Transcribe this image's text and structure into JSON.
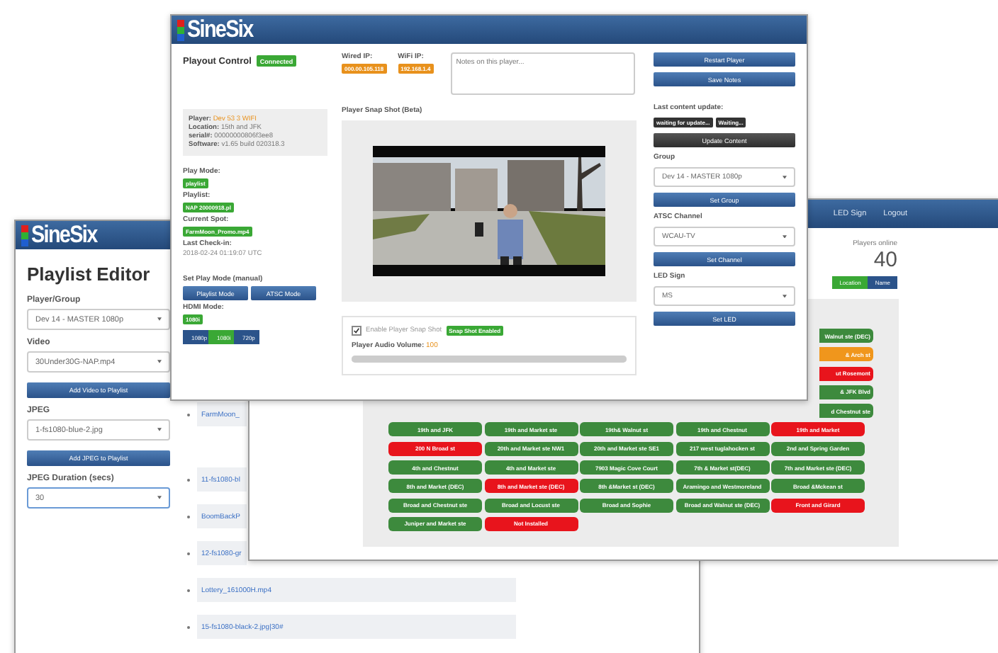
{
  "dashboard": {
    "nav": [
      "LED Sign",
      "Logout"
    ],
    "players_online_label": "Players online",
    "players_online": "40",
    "sort_toggle": [
      {
        "label": "Location",
        "selected": true
      },
      {
        "label": "Name",
        "selected": false
      }
    ],
    "locations": [
      {
        "kind": "partial",
        "cells": [
          {
            "label": "Walnut ste (DEC)",
            "color": "#3d8a3d"
          }
        ]
      },
      {
        "kind": "partial",
        "cells": [
          {
            "label": "& Arch st",
            "color": "#f0961c"
          }
        ]
      },
      {
        "kind": "partial",
        "cells": [
          {
            "label": "ut Rosemont",
            "color": "#e8141c"
          }
        ]
      },
      {
        "kind": "partial",
        "cells": [
          {
            "label": "& JFK Blvd",
            "color": "#3d8a3d"
          }
        ]
      },
      {
        "kind": "partial",
        "cells": [
          {
            "label": "d Chestnut ste",
            "color": "#3d8a3d"
          }
        ]
      },
      {
        "kind": "full",
        "cells": [
          {
            "label": "19th and JFK",
            "color": "#3d8a3d"
          },
          {
            "label": "19th and Market ste",
            "color": "#3d8a3d"
          },
          {
            "label": "19th& Walnut st",
            "color": "#3d8a3d"
          },
          {
            "label": "19th and Chestnut",
            "color": "#3d8a3d"
          },
          {
            "label": "19th and Market",
            "color": "#e8141c"
          }
        ]
      },
      {
        "kind": "full",
        "cells": [
          {
            "label": "200 N Broad st",
            "color": "#e8141c"
          },
          {
            "label": "20th and Market ste NW1",
            "color": "#3d8a3d"
          },
          {
            "label": "20th and Market ste SE1",
            "color": "#3d8a3d"
          },
          {
            "label": "217 west tuglahocken st",
            "color": "#3d8a3d"
          },
          {
            "label": "2nd and Spring Garden",
            "color": "#3d8a3d"
          }
        ]
      },
      {
        "kind": "full",
        "cells": [
          {
            "label": "4th and Chestnut",
            "color": "#3d8a3d"
          },
          {
            "label": "4th and Market ste",
            "color": "#3d8a3d"
          },
          {
            "label": "7903 Magic Cove Court",
            "color": "#3d8a3d"
          },
          {
            "label": "7th & Market st(DEC)",
            "color": "#3d8a3d"
          },
          {
            "label": "7th and Market ste (DEC)",
            "color": "#3d8a3d"
          }
        ]
      },
      {
        "kind": "full",
        "cells": [
          {
            "label": "8th and Market (DEC)",
            "color": "#3d8a3d"
          },
          {
            "label": "8th and Market ste (DEC)",
            "color": "#e8141c"
          },
          {
            "label": "8th &Market st (DEC)",
            "color": "#3d8a3d"
          },
          {
            "label": "Aramingo and Westmoreland",
            "color": "#3d8a3d"
          },
          {
            "label": "Broad &Mckean st",
            "color": "#3d8a3d"
          }
        ]
      },
      {
        "kind": "full",
        "cells": [
          {
            "label": "Broad and Chestnut ste",
            "color": "#3d8a3d"
          },
          {
            "label": "Broad and Locust ste",
            "color": "#3d8a3d"
          },
          {
            "label": "Broad and Sophie",
            "color": "#3d8a3d"
          },
          {
            "label": "Broad and Walnut ste (DEC)",
            "color": "#3d8a3d"
          },
          {
            "label": "Front and Girard",
            "color": "#e8141c"
          }
        ]
      },
      {
        "kind": "full",
        "cells": [
          {
            "label": "Juniper and Market ste",
            "color": "#3d8a3d"
          },
          {
            "label": "Not Installed",
            "color": "#e8141c"
          }
        ]
      }
    ]
  },
  "playlist_editor": {
    "logo": "SineSix",
    "title": "Playlist Editor",
    "fields": [
      {
        "label": "Player/Group",
        "value": "Dev 14 - MASTER 1080p"
      },
      {
        "label": "Video",
        "value": "30Under30G-NAP.mp4",
        "button": "Add Video to Playlist"
      },
      {
        "label": "JPEG",
        "value": "1-fs1080-blue-2.jpg",
        "button": "Add JPEG to Playlist"
      },
      {
        "label": "JPEG Duration (secs)",
        "value": "30"
      }
    ],
    "items": [
      {
        "name": "FarmMoon_",
        "kind": "covered"
      },
      {
        "name": "11-fs1080-bl",
        "kind": "covered"
      },
      {
        "name": "BoomBackP",
        "kind": "covered"
      },
      {
        "name": "12-fs1080-gr",
        "kind": "covered"
      },
      {
        "name": "Lottery_161000H.mp4",
        "kind": "full"
      },
      {
        "name": "15-fs1080-black-2.jpg|30#",
        "kind": "full"
      }
    ]
  },
  "playout": {
    "logo": "SineSix",
    "title": "Playout Control",
    "status": "Connected",
    "wired_ip": {
      "label": "Wired IP:",
      "value": "000.00.105.118"
    },
    "wifi_ip": {
      "label": "WiFi IP:",
      "value": "192.168.1.4"
    },
    "notes_placeholder": "Notes on this player...",
    "info": [
      {
        "label": "Player:",
        "value": "Dev 53 3 WIFI",
        "highlight": true
      },
      {
        "label": "Location:",
        "value": "15th and JFK",
        "highlight": false
      },
      {
        "label": "serial#:",
        "value": "00000000806f3ee8",
        "highlight": false
      },
      {
        "label": "Software:",
        "value": "v1.65 build 020318.3",
        "highlight": false
      }
    ],
    "status_items": [
      {
        "label": "Play Mode:",
        "badge": "playlist"
      },
      {
        "label": "Playlist:",
        "badge": "NAP 20000918.pl"
      },
      {
        "label": "Current Spot:",
        "badge": "FarmMoon_Promo.mp4"
      }
    ],
    "last_checkin_label": "Last Check-in:",
    "last_checkin": "2018-02-24 01:19:07 UTC",
    "play_mode_label": "Set Play Mode (manual)",
    "play_mode_buttons": [
      "Playlist Mode",
      "ATSC Mode"
    ],
    "hdmi_label": "HDMI Mode:",
    "hdmi_badge": "1080i",
    "hdmi_options": [
      {
        "label": "1080p",
        "selected": false
      },
      {
        "label": "1080i",
        "selected": true
      },
      {
        "label": "720p",
        "selected": false
      }
    ],
    "snapshot_title": "Player Snap Shot (Beta)",
    "snapshot_checkbox": {
      "label": "Enable Player Snap Shot",
      "checked": true
    },
    "snapshot_badge": "Snap Shot Enabled",
    "volume": {
      "label": "Player Audio Volume:",
      "reading": "100",
      "level": 1.0
    },
    "action_buttons": [
      "Restart Player",
      "Save Notes"
    ],
    "last_update_label": "Last content update:",
    "last_update_badges": [
      "waiting for update...",
      "Waiting..."
    ],
    "update_button": "Update Content",
    "selects": [
      {
        "label": "Group",
        "value": "Dev 14 - MASTER 1080p",
        "button": "Set Group"
      },
      {
        "label": "ATSC Channel",
        "value": "WCAU-TV",
        "button": "Set Channel"
      },
      {
        "label": "LED Sign",
        "value": "MS",
        "button": "Set LED"
      }
    ]
  }
}
